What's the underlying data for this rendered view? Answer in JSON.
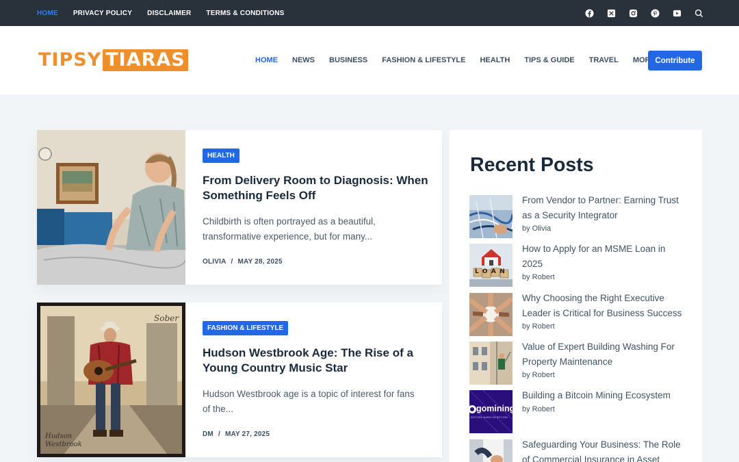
{
  "topbar": {
    "nav": [
      "HOME",
      "PRIVACY POLICY",
      "DISCLAIMER",
      "TERMS & CONDITIONS"
    ],
    "social_icons": [
      "facebook-icon",
      "x-icon",
      "instagram-icon",
      "pinterest-icon",
      "youtube-icon",
      "search-icon"
    ]
  },
  "header": {
    "logo_part1": "TIPSY",
    "logo_part2": "TIARAS",
    "nav": [
      "HOME",
      "NEWS",
      "BUSINESS",
      "FASHION & LIFESTYLE",
      "HEALTH",
      "TIPS & GUIDE",
      "TRAVEL",
      "MORE"
    ],
    "contribute_label": "Contribute"
  },
  "posts": [
    {
      "category": "HEALTH",
      "title": "From Delivery Room to Diagnosis: When Something Feels Off",
      "excerpt": "Childbirth is often portrayed as a beautiful, transformative experience, but for many...",
      "author": "OLIVIA",
      "date": "MAY 28, 2025"
    },
    {
      "category": "FASHION & LIFESTYLE",
      "title": "Hudson Westbrook Age: The Rise of a Young Country Music Star",
      "excerpt": "Hudson Westbrook age is a topic of interest for fans of the...",
      "author": "DM",
      "date": "MAY 27, 2025",
      "image_text_sober": "Sober",
      "image_text_signature": "Hudson Westbrook"
    }
  ],
  "sidebar": {
    "heading": "Recent Posts",
    "items": [
      {
        "title": "From Vendor to Partner: Earning Trust as a Security Integrator",
        "byline": "by Olivia"
      },
      {
        "title": "How to Apply for an MSME Loan in 2025",
        "byline": "by Robert",
        "image_text": "LOAN"
      },
      {
        "title": "Why Choosing the Right Executive Leader is Critical for Business Success",
        "byline": "by Robert"
      },
      {
        "title": "Value of Expert Building Washing For Property Maintenance",
        "byline": "by Robert"
      },
      {
        "title": "Building a Bitcoin Mining Ecosystem",
        "byline": "by Robert",
        "image_text": "gomining",
        "image_subtext": "BITCOIN. EARN ON BITCOIN"
      },
      {
        "title": "Safeguarding Your Business: The Role of Commercial Insurance in Asset",
        "byline": ""
      }
    ]
  },
  "colors": {
    "accent": "#2268e5",
    "topbar": "#29313a",
    "logo": "#ee8f2b",
    "background": "#f2f5f7"
  }
}
